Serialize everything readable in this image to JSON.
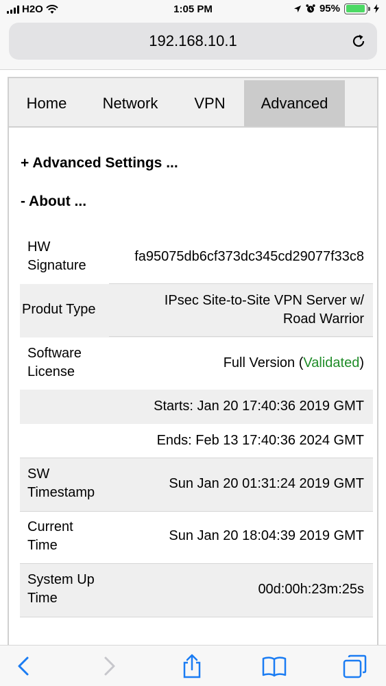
{
  "status_bar": {
    "carrier": "H2O",
    "time": "1:05 PM",
    "battery_percent": "95%",
    "battery_level": 0.95
  },
  "browser": {
    "url": "192.168.10.1"
  },
  "tabs": [
    {
      "label": "Home",
      "active": false
    },
    {
      "label": "Network",
      "active": false
    },
    {
      "label": "VPN",
      "active": false
    },
    {
      "label": "Advanced",
      "active": true
    }
  ],
  "sections": {
    "advanced_settings": "+ Advanced Settings ...",
    "about": "- About ..."
  },
  "about": {
    "hw_signature_label_1": "HW",
    "hw_signature_label_2": "Signature",
    "hw_signature_value": "fa95075db6cf373dc345cd29077f33c8",
    "product_type_label": "Produt Type",
    "product_type_value_1": "IPsec Site-to-Site VPN Server w/",
    "product_type_value_2": "Road Warrior",
    "license_label_1": "Software",
    "license_label_2": "License",
    "license_value_prefix": "Full Version (",
    "license_value_status": "Validated",
    "license_value_suffix": ")",
    "license_starts": "Starts: Jan 20 17:40:36 2019 GMT",
    "license_ends": "Ends: Feb 13 17:40:36 2024 GMT",
    "sw_timestamp_label_1": "SW",
    "sw_timestamp_label_2": "Timestamp",
    "sw_timestamp_value": "Sun Jan 20 01:31:24 2019 GMT",
    "current_time_label_1": "Current",
    "current_time_label_2": "Time",
    "current_time_value": "Sun Jan 20 18:04:39 2019 GMT",
    "uptime_label_1": "System Up",
    "uptime_label_2": "Time",
    "uptime_value": "00d:00h:23m:25s"
  },
  "colors": {
    "validated": "#1f8c28",
    "ios_blue": "#1a7cf3",
    "active_tab": "#cbcbcb"
  },
  "icons": [
    "signal-icon",
    "wifi-icon",
    "location-icon",
    "alarm-icon",
    "battery-icon",
    "charging-icon",
    "reload-icon",
    "back-icon",
    "forward-icon",
    "share-icon",
    "bookmarks-icon",
    "tabs-icon"
  ]
}
